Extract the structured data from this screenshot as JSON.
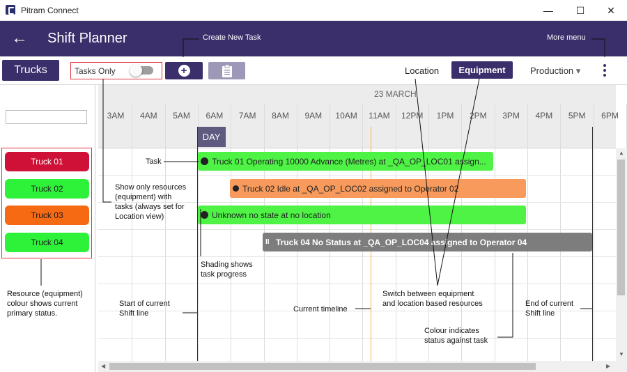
{
  "window": {
    "title": "Pitram Connect",
    "min_glyph": "—",
    "max_glyph": "☐",
    "close_glyph": "✕"
  },
  "header": {
    "back_glyph": "←",
    "title": "Shift Planner"
  },
  "toolbar": {
    "resource_button": "Trucks",
    "tasks_only_label": "Tasks Only",
    "add_glyph": "+",
    "location_label": "Location",
    "equipment_label": "Equipment",
    "production_label": "Production",
    "dropdown_glyph": "▾"
  },
  "timeline": {
    "date": "23 MARCH",
    "hours": [
      "3AM",
      "4AM",
      "5AM",
      "6AM",
      "7AM",
      "8AM",
      "9AM",
      "10AM",
      "11AM",
      "12PM",
      "1PM",
      "2PM",
      "3PM",
      "4PM",
      "5PM",
      "6PM"
    ],
    "day_label": "DAY"
  },
  "resources": [
    {
      "label": "Truck 01",
      "color": "#d01137",
      "text_color": "#ffffff"
    },
    {
      "label": "Truck 02",
      "color": "#2ef23a",
      "text_color": "#1a1a1a"
    },
    {
      "label": "Truck 03",
      "color": "#f76a14",
      "text_color": "#1a1a1a"
    },
    {
      "label": "Truck 04",
      "color": "#2ef23a",
      "text_color": "#1a1a1a"
    }
  ],
  "tasks": [
    {
      "label": "Truck 01 Operating 10000 Advance (Metres) at _QA_OP_LOC01 assign...",
      "color": "#4ef346",
      "icon": "operating-icon"
    },
    {
      "label": "Truck 02 Idle at _QA_OP_LOC02 assigned to Operator 02",
      "color": "#f79a5c",
      "icon": "idle-icon"
    },
    {
      "label": "Unknown no state at no location",
      "color": "#4ef346",
      "icon": "unknown-icon"
    },
    {
      "label": "Truck 04 No Status at _QA_OP_LOC04 assigned to Operator 04",
      "color": "#7d7d7d",
      "icon": "pause-icon"
    }
  ],
  "annotations": {
    "create_new_task": "Create New Task",
    "more_menu": "More menu",
    "task": "Task",
    "show_only_resources": [
      "Show only resources",
      "(equipment) with",
      "tasks (always set for",
      "Location view)"
    ],
    "shading": [
      "Shading shows",
      "task progress"
    ],
    "resource_colour": [
      "Resource (equipment)",
      "colour shows current",
      "primary status."
    ],
    "start_shift": [
      "Start of current",
      "Shift line"
    ],
    "current_timeline": "Current timeline",
    "switch": [
      "Switch between equipment",
      "and location based resources"
    ],
    "end_shift": [
      "End of current",
      "Shift line"
    ],
    "colour_indicates": [
      "Colour indicates",
      "status against task"
    ]
  }
}
